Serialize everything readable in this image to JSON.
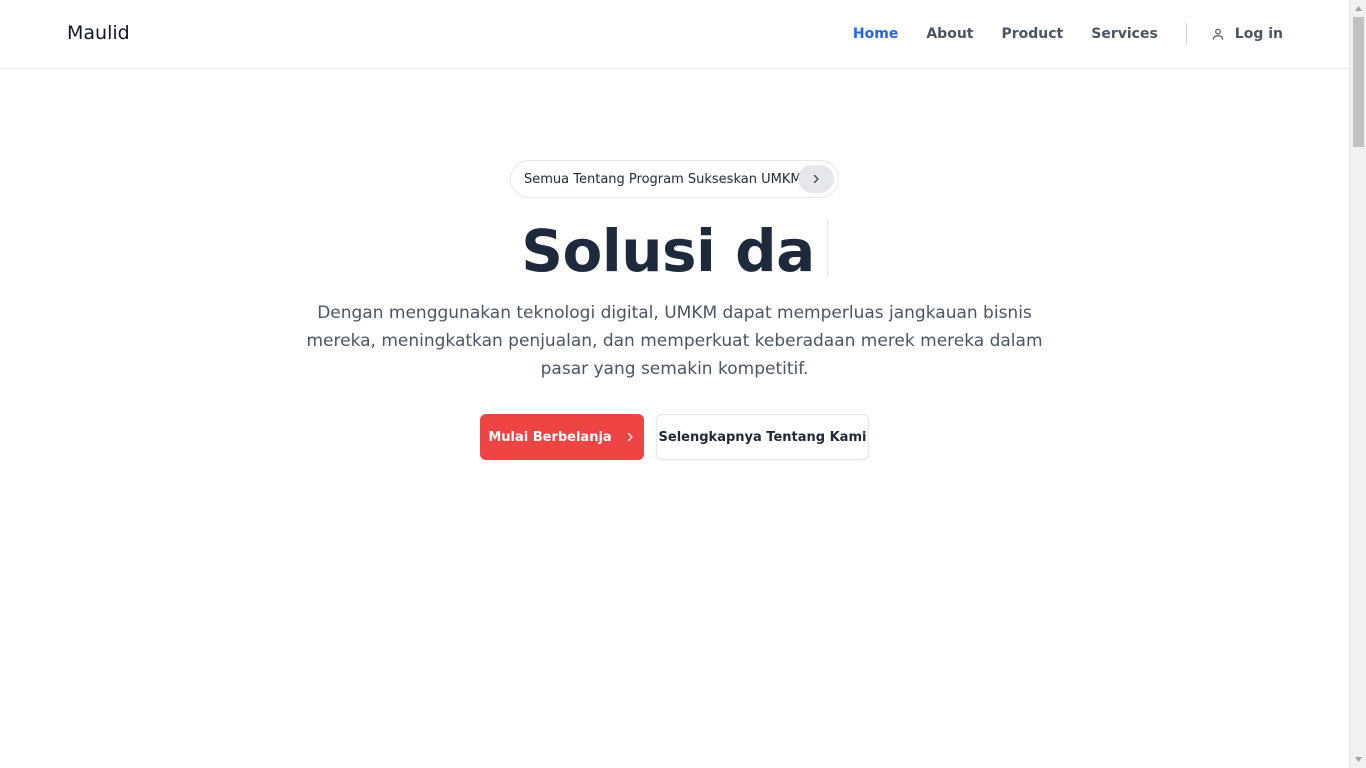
{
  "header": {
    "brand": "Maulid",
    "nav": [
      "Home",
      "About",
      "Product",
      "Services"
    ],
    "active_nav": "Home",
    "login_label": "Log in"
  },
  "hero": {
    "announcement": "Semua Tentang Program Sukseskan UMKM",
    "title": "Solusi da",
    "description": "Dengan menggunakan teknologi digital, UMKM dapat memperluas jangkauan bisnis mereka, meningkatkan penjualan, dan memperkuat keberadaan merek mereka dalam pasar yang semakin kompetitif.",
    "primary_cta": "Mulai Berbelanja",
    "secondary_cta": "Selengkapnya Tentang Kami"
  },
  "colors": {
    "accent": "#2563eb",
    "primary_button": "#ef4444",
    "title": "#1e293b"
  },
  "icons": {
    "login": "user-icon",
    "announcement": "chevron-right-icon",
    "primary_cta": "chevron-right-icon"
  }
}
